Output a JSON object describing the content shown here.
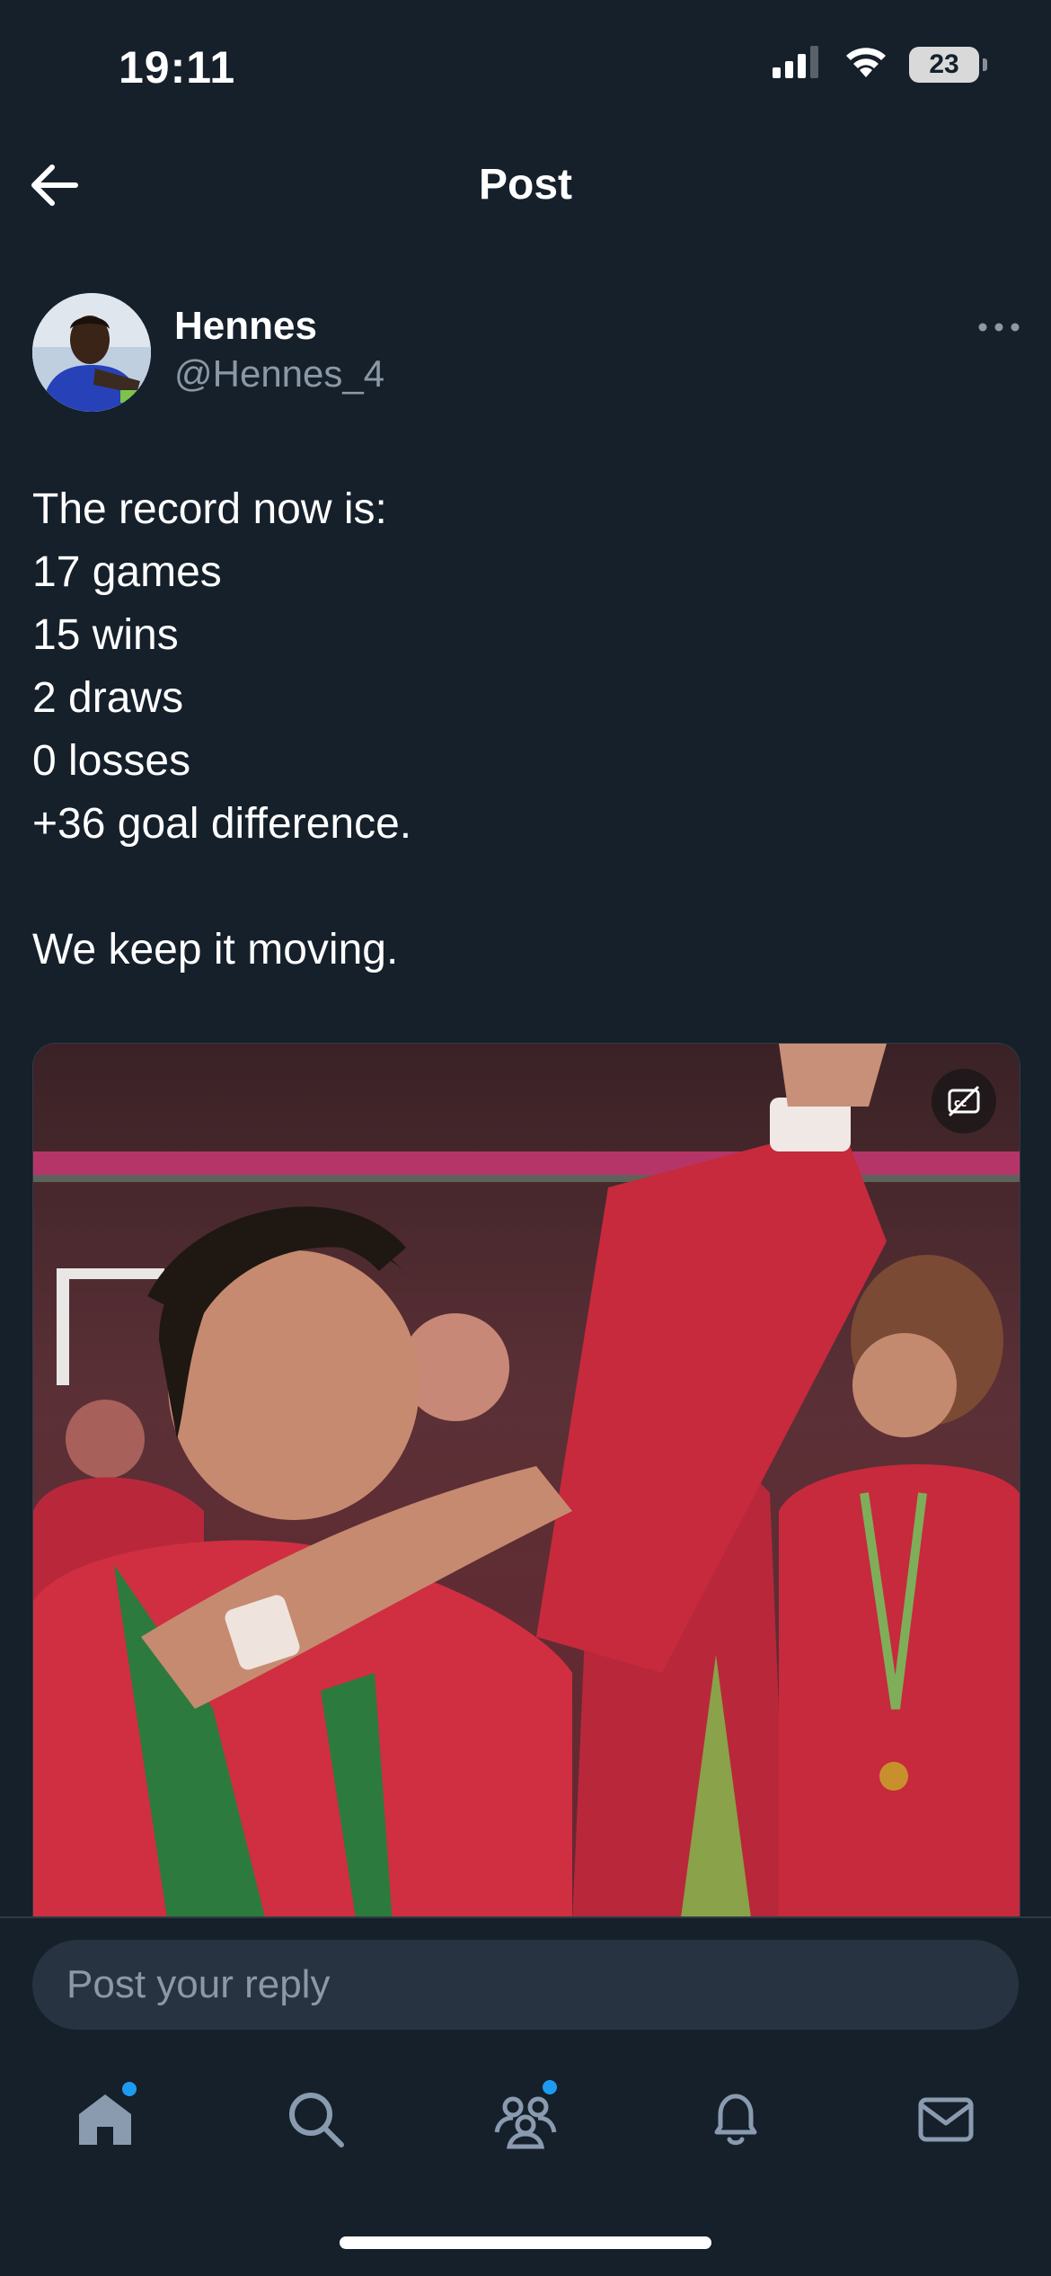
{
  "status_bar": {
    "time": "19:11",
    "battery_level": "23",
    "icons": [
      "cellular-signal-icon",
      "wifi-icon",
      "battery-icon"
    ]
  },
  "header": {
    "title": "Post",
    "back_icon": "arrow-left-icon"
  },
  "post": {
    "author": {
      "name": "Hennes",
      "handle": "@Hennes_4"
    },
    "more_icon": "more-horizontal-icon",
    "text_lines": [
      "The record now is:",
      "17 games",
      "15 wins",
      "2 draws",
      "0 losses",
      "+36 goal difference.",
      "",
      "We keep it moving."
    ],
    "media": {
      "type": "video",
      "caption_icon": "closed-captions-off-icon"
    }
  },
  "reply": {
    "placeholder": "Post your reply"
  },
  "bottom_nav": {
    "items": [
      {
        "icon": "home-icon",
        "active": true,
        "badge": true
      },
      {
        "icon": "search-icon",
        "active": false,
        "badge": false
      },
      {
        "icon": "communities-icon",
        "active": false,
        "badge": true
      },
      {
        "icon": "notifications-bell-icon",
        "active": false,
        "badge": false
      },
      {
        "icon": "messages-envelope-icon",
        "active": false,
        "badge": false
      }
    ]
  },
  "colors": {
    "background": "#15202b",
    "text_primary": "#ffffff",
    "text_secondary": "#8b98a5",
    "accent": "#1d9bf0",
    "input_bg": "#273340",
    "divider": "#2f3a45"
  }
}
